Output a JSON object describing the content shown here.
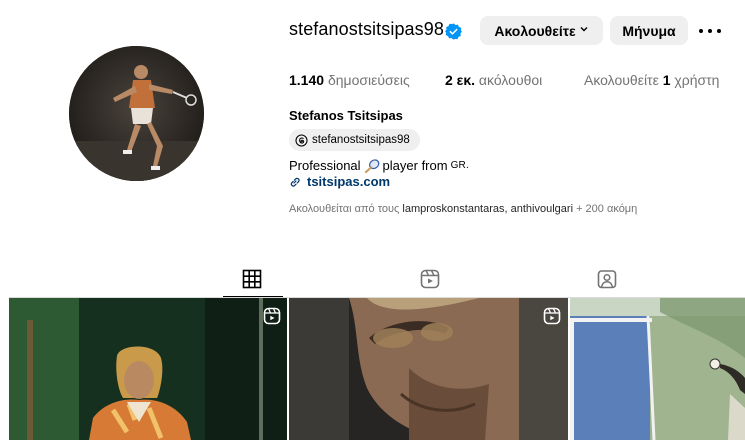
{
  "profile": {
    "username": "stefanostsitsipas98",
    "verified": true,
    "follow_button": "Ακολουθείτε",
    "message_button": "Μήνυμα",
    "full_name": "Stefanos Tsitsipas",
    "threads_handle": "stefanostsitsipas98",
    "bio_prefix": "Professional",
    "bio_suffix": "player from",
    "bio_flag": "GR.",
    "link": "tsitsipas.com"
  },
  "stats": {
    "posts_count": "1.140",
    "posts_label": "δημοσιεύσεις",
    "followers_count": "2 εκ.",
    "followers_label": "ακόλουθοι",
    "following_label": "Ακολουθείτε",
    "following_count": "1",
    "following_unit": "χρήστη"
  },
  "followed_by": {
    "prefix": "Ακολουθείται από τους",
    "user1": "lamproskonstantaras",
    "user2": "anthivoulgari",
    "suffix": "+ 200 ακόμη"
  },
  "tabs": [
    {
      "icon": "grid-icon",
      "active": true
    },
    {
      "icon": "reels-icon",
      "active": false
    },
    {
      "icon": "tagged-icon",
      "active": false
    }
  ],
  "grid": [
    {
      "type": "reel"
    },
    {
      "type": "reel"
    },
    {
      "type": "photo"
    }
  ],
  "colors": {
    "verified": "#0095f6",
    "link": "#00376b",
    "button_bg": "#efefef",
    "muted_text": "#737373"
  }
}
